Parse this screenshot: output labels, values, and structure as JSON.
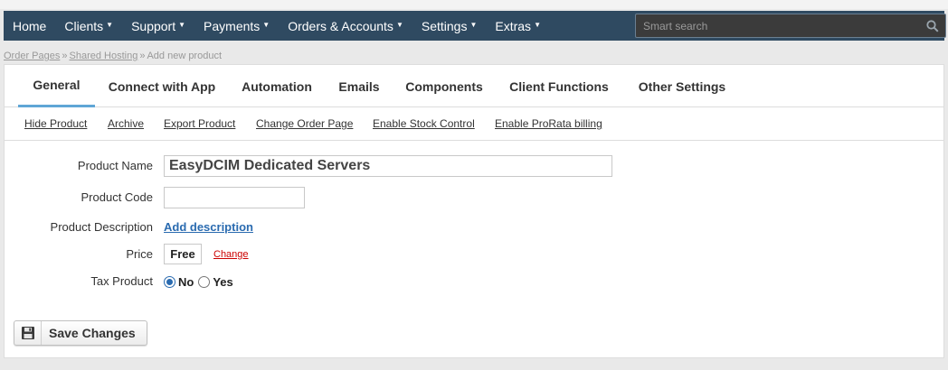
{
  "nav": {
    "items": [
      {
        "label": "Home",
        "caret": false
      },
      {
        "label": "Clients",
        "caret": true
      },
      {
        "label": "Support",
        "caret": true
      },
      {
        "label": "Payments",
        "caret": true
      },
      {
        "label": "Orders & Accounts",
        "caret": true
      },
      {
        "label": "Settings",
        "caret": true
      },
      {
        "label": "Extras",
        "caret": true
      }
    ],
    "search_placeholder": "Smart search"
  },
  "breadcrumb": {
    "items": [
      "Order Pages",
      "Shared Hosting"
    ],
    "current": "Add new product",
    "separator": "»"
  },
  "tabs": [
    "General",
    "Connect with App",
    "Automation",
    "Emails",
    "Components",
    "Client Functions",
    "Other Settings"
  ],
  "active_tab": "General",
  "actions": [
    "Hide Product",
    "Archive",
    "Export Product",
    "Change Order Page",
    "Enable Stock Control",
    "Enable ProRata billing"
  ],
  "form": {
    "product_name_label": "Product Name",
    "product_name_value": "EasyDCIM Dedicated Servers",
    "product_code_label": "Product Code",
    "product_code_value": "",
    "product_description_label": "Product Description",
    "add_description_link": "Add description",
    "price_label": "Price",
    "price_value": "Free",
    "change_link": "Change",
    "tax_label": "Tax Product",
    "tax_options": [
      "No",
      "Yes"
    ],
    "tax_selected": "No"
  },
  "save_button": {
    "label": "Save Changes",
    "icon": "floppy-disk-icon"
  },
  "colors": {
    "navbar": "#2f4a61",
    "active_tab_underline": "#5fa6d6",
    "link_blue": "#2a6bb0",
    "change_red": "#cc0000"
  }
}
